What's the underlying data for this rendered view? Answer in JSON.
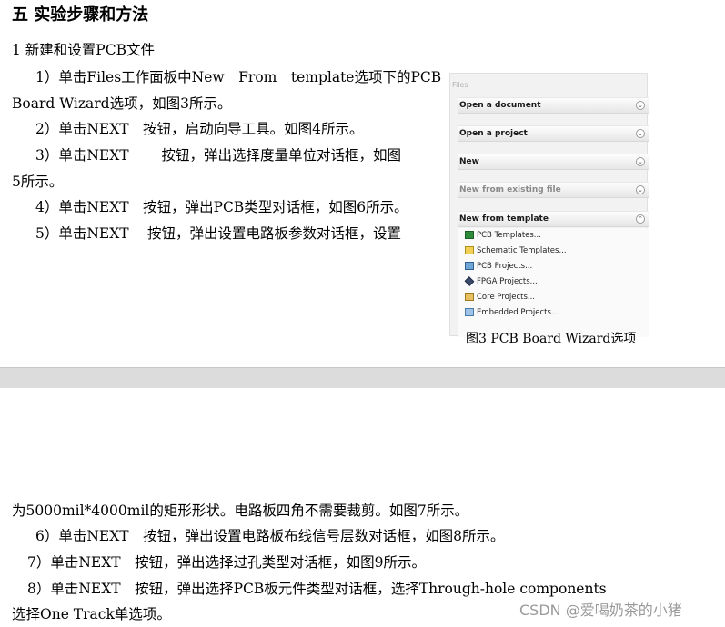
{
  "heading": "五  实验步骤和方法",
  "subheading": "1 新建和设置PCB文件",
  "lines_top": [
    "1）单击Files工作面板中New　From　template选项下的PCB",
    "Board Wizard选项，如图3所示。",
    "2）单击NEXT　按钮，启动向导工具。如图4所示。",
    "3）单击NEXT　　 按钮，弹出选择度量单位对话框，如图",
    "5所示。",
    "4）单击NEXT　按钮，弹出PCB类型对话框，如图6所示。",
    "5）单击NEXT　 按钮，弹出设置电路板参数对话框，设置"
  ],
  "files_panel": {
    "title": "Files",
    "sections": [
      {
        "label": "Open a document",
        "expanded": false,
        "disabled": false
      },
      {
        "label": "Open a project",
        "expanded": false,
        "disabled": false
      },
      {
        "label": "New",
        "expanded": false,
        "disabled": false
      },
      {
        "label": "New from existing file",
        "expanded": false,
        "disabled": true
      },
      {
        "label": "New from template",
        "expanded": true,
        "disabled": false
      }
    ],
    "template_items": [
      {
        "label": "PCB Templates...",
        "icon": "pcb-icon"
      },
      {
        "label": "Schematic Templates...",
        "icon": "schematic-icon"
      },
      {
        "label": "PCB Projects...",
        "icon": "project-icon"
      },
      {
        "label": "FPGA Projects...",
        "icon": "fpga-icon"
      },
      {
        "label": "Core Projects...",
        "icon": "core-icon"
      },
      {
        "label": "Embedded Projects...",
        "icon": "embedded-icon"
      }
    ]
  },
  "caption": "图3 PCB Board Wizard选项",
  "lines_bottom": [
    "为5000mil*4000mil的矩形形状。电路板四角不需要裁剪。如图7所示。",
    "6）单击NEXT　按钮，弹出设置电路板布线信号层数对话框，如图8所示。",
    "7）单击NEXT　按钮，弹出选择过孔类型对话框，如图9所示。",
    "8）单击NEXT　按钮，弹出选择PCB板元件类型对话框，选择Through-hole components",
    "选择One Track单选项。"
  ],
  "watermark": "CSDN @爱喝奶茶的小猪"
}
